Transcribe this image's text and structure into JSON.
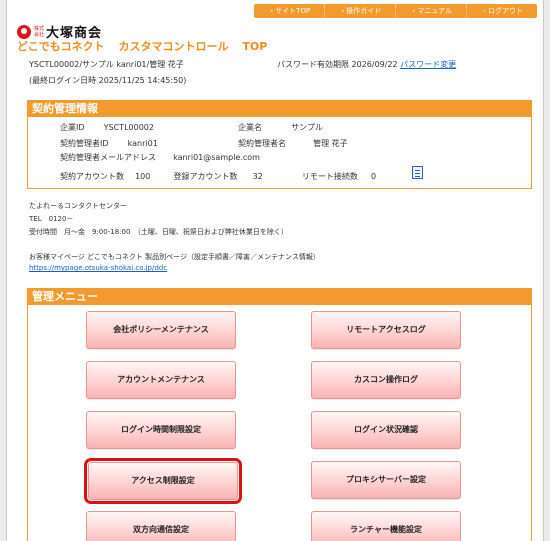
{
  "topnav": [
    "・サイトTOP",
    "・操作ガイド",
    "・マニュアル",
    "・ログアウト"
  ],
  "logo": {
    "small": "株式会社",
    "text": "大塚商会"
  },
  "app_title": {
    "part1": "どこでもコネクト",
    "part2": "カスタマコントロール",
    "part3": "TOP"
  },
  "user_line": "YSCTL00002/サンプル kanri01/管理 花子",
  "last_login": "(最終ログイン日時 2025/11/25 14:45:50)",
  "password": {
    "label": "パスワード有効期限 2026/09/22",
    "link": "パスワード変更"
  },
  "contract": {
    "title": "契約管理情報",
    "company_id_label": "企業ID",
    "company_id": "YSCTL00002",
    "company_name_label": "企業名",
    "company_name": "サンプル",
    "admin_id_label": "契約管理者ID",
    "admin_id": "kanri01",
    "admin_name_label": "契約管理者名",
    "admin_name": "管理 花子",
    "admin_mail_label": "契約管理者メールアドレス",
    "admin_mail": "kanri01@sample.com",
    "accounts_label": "契約アカウント数",
    "accounts": "100",
    "registered_label": "登録アカウント数",
    "registered": "32",
    "remote_label": "リモート接続数",
    "remote": "0"
  },
  "contact": {
    "center": "たよれーるコンタクトセンター",
    "tel": "TEL　0120－",
    "hours": "受付時間　月～金　9:00-18:00　（土曜、日曜、祝祭日および弊社休業日を除く）"
  },
  "mypage": {
    "text": "お客様マイページ どこでもコネクト 製品別ページ（設定手順書／障害／メンテナンス情報）",
    "link": "https://mypage.otsuka-shokai.co.jp/ddc"
  },
  "menu": {
    "title": "管理メニュー",
    "buttons": [
      "会社ポリシーメンテナンス",
      "リモートアクセスログ",
      "アカウントメンテナンス",
      "カスコン操作ログ",
      "ログイン時間制限設定",
      "ログイン状況確認",
      "アクセス制限設定",
      "プロキシサーバー設定",
      "双方向通信設定",
      "ランチャー機能設定"
    ]
  },
  "colors": {
    "brand_orange": "#f39a2e",
    "highlight_red": "#e10f0f",
    "logo_red": "#d7191c",
    "link_blue": "#1a5fc7"
  },
  "icons": {
    "contract_doc": "document-icon",
    "logo": "otsuka-logo-icon"
  }
}
